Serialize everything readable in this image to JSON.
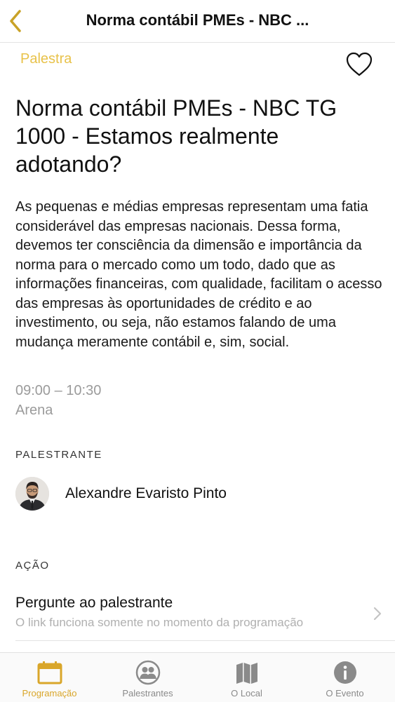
{
  "nav": {
    "title": "Norma contábil PMEs - NBC ...",
    "back_icon": "chevron-left-icon",
    "accent_color": "#c9a227"
  },
  "session": {
    "category": "Palestra",
    "category_color": "#e8c24a",
    "favorite_icon": "heart-outline-icon",
    "title": "Norma contábil PMEs - NBC TG 1000 - Estamos realmente adotando?",
    "description": "As pequenas e médias empresas representam uma fatia considerável das empresas nacionais. Dessa forma, devemos ter consciência da dimensão e importância da norma para o mercado como um todo, dado que as informações financeiras, com qualidade, facilitam o acesso das empresas às oportunidades de crédito e ao investimento, ou seja, não estamos falando de uma mudança meramente contábil e, sim, social.",
    "time": "09:00 – 10:30",
    "location": "Arena"
  },
  "speakers": {
    "section_label": "PALESTRANTE",
    "items": [
      {
        "name": "Alexandre Evaristo Pinto",
        "avatar": "speaker-photo"
      }
    ]
  },
  "actions": {
    "section_label": "AÇÃO",
    "items": [
      {
        "title": "Pergunte ao palestrante",
        "subtitle": "O link funciona somente no momento da programação",
        "icon": "chevron-right-icon"
      }
    ]
  },
  "tabbar": {
    "active_color": "#d9a62a",
    "inactive_color": "#8a8a8a",
    "tabs": [
      {
        "label": "Programação",
        "icon": "calendar-icon",
        "active": true
      },
      {
        "label": "Palestrantes",
        "icon": "people-icon",
        "active": false
      },
      {
        "label": "O Local",
        "icon": "map-icon",
        "active": false
      },
      {
        "label": "O Evento",
        "icon": "info-icon",
        "active": false
      }
    ]
  }
}
